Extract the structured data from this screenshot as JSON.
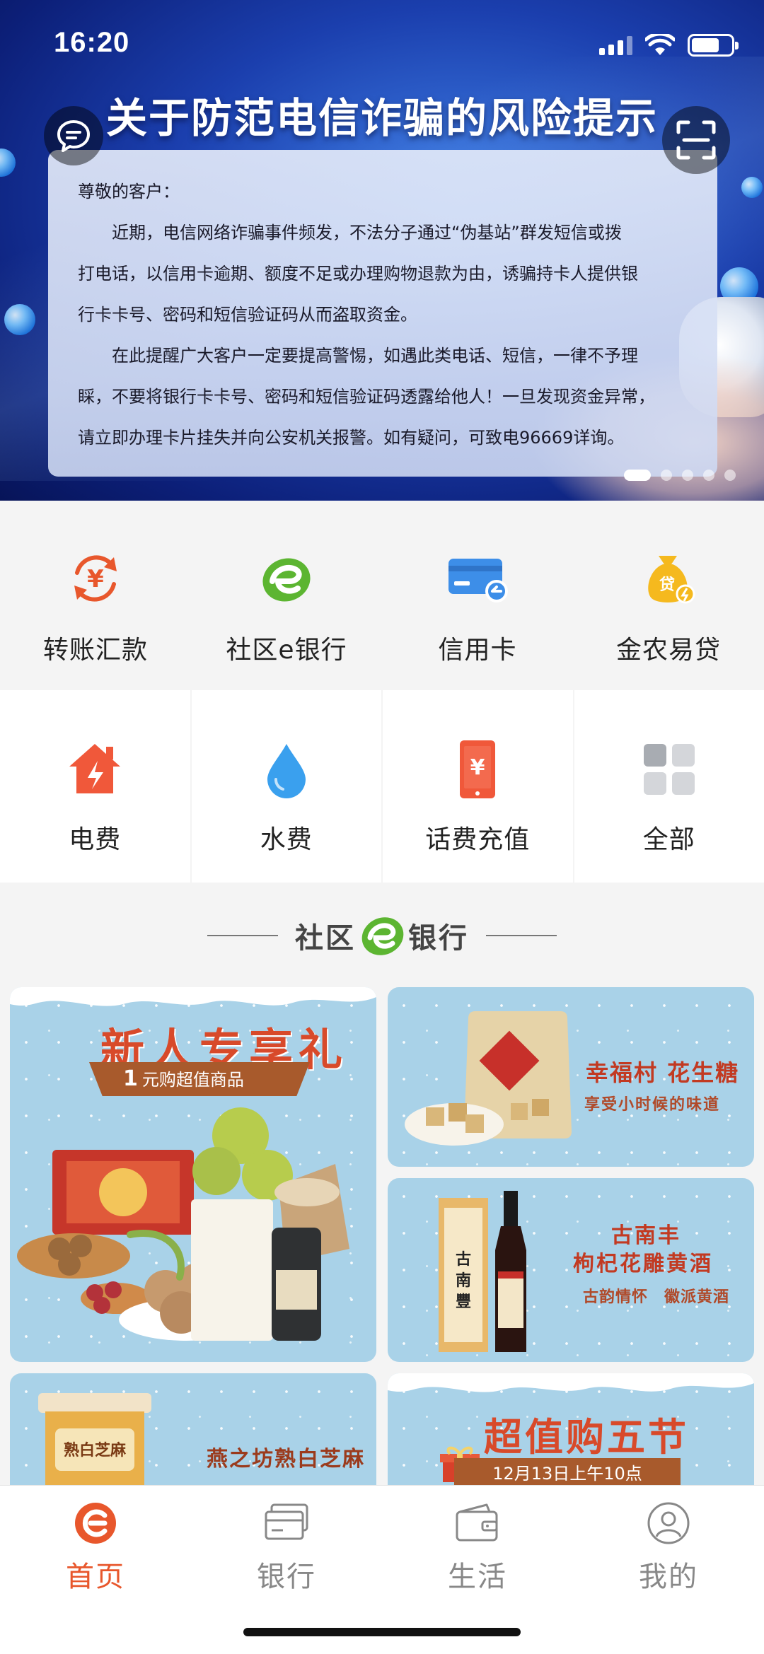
{
  "status_bar": {
    "time": "16:20"
  },
  "banner": {
    "title": "关于防范电信诈骗的风险提示",
    "greeting": "尊敬的客户：",
    "para1_lines": [
      "近期，电信网络诈骗事件频发，不法分子通过“伪基站”群发短信或拨",
      "打电话，以信用卡逾期、额度不足或办理购物退款为由，诱骗持卡人提供银",
      "行卡卡号、密码和短信验证码从而盗取资金。"
    ],
    "para2_lines": [
      "在此提醒广大客户一定要提高警惕，如遇此类电话、短信，一律不予理",
      "睬，不要将银行卡卡号、密码和短信验证码透露给他人！一旦发现资金异常，",
      "请立即办理卡片挂失并向公安机关报警。如有疑问，可致电96669详询。"
    ],
    "carousel_count": 5,
    "carousel_active": 1
  },
  "quick_actions": [
    {
      "label": "转账汇款",
      "icon": "transfer-yuan-icon"
    },
    {
      "label": "社区e银行",
      "icon": "e-bank-icon"
    },
    {
      "label": "信用卡",
      "icon": "credit-card-icon"
    },
    {
      "label": "金农易贷",
      "icon": "loan-bag-icon"
    }
  ],
  "services": [
    {
      "label": "电费",
      "icon": "electricity-house-icon"
    },
    {
      "label": "水费",
      "icon": "water-drop-icon"
    },
    {
      "label": "话费充值",
      "icon": "phone-topup-icon"
    },
    {
      "label": "全部",
      "icon": "grid-all-icon"
    }
  ],
  "section": {
    "title_left": "社区",
    "title_right": "银行"
  },
  "promos": {
    "p1": {
      "title": "新人专享礼",
      "ribbon_num": "1",
      "ribbon_text": "元购超值商品"
    },
    "p2": {
      "title": "幸福村 花生糖",
      "subtitle": "享受小时候的味道"
    },
    "p3": {
      "title1": "古南丰",
      "title2": "枸杞花雕黄酒",
      "subtitle": "古韵情怀　徽派黄酒"
    },
    "p4": {
      "title": "燕之坊熟白芝麻"
    },
    "p5": {
      "title": "超值购五节",
      "ribbon": "12月13日上午10点"
    }
  },
  "tabbar": [
    {
      "label": "首页",
      "icon": "home-icon",
      "active": true
    },
    {
      "label": "银行",
      "icon": "bank-card-icon",
      "active": false
    },
    {
      "label": "生活",
      "icon": "wallet-icon",
      "active": false
    },
    {
      "label": "我的",
      "icon": "profile-icon",
      "active": false
    }
  ],
  "colors": {
    "accent": "#e8572c",
    "e_green": "#5cb531",
    "card_blue": "#3d8ee8"
  }
}
